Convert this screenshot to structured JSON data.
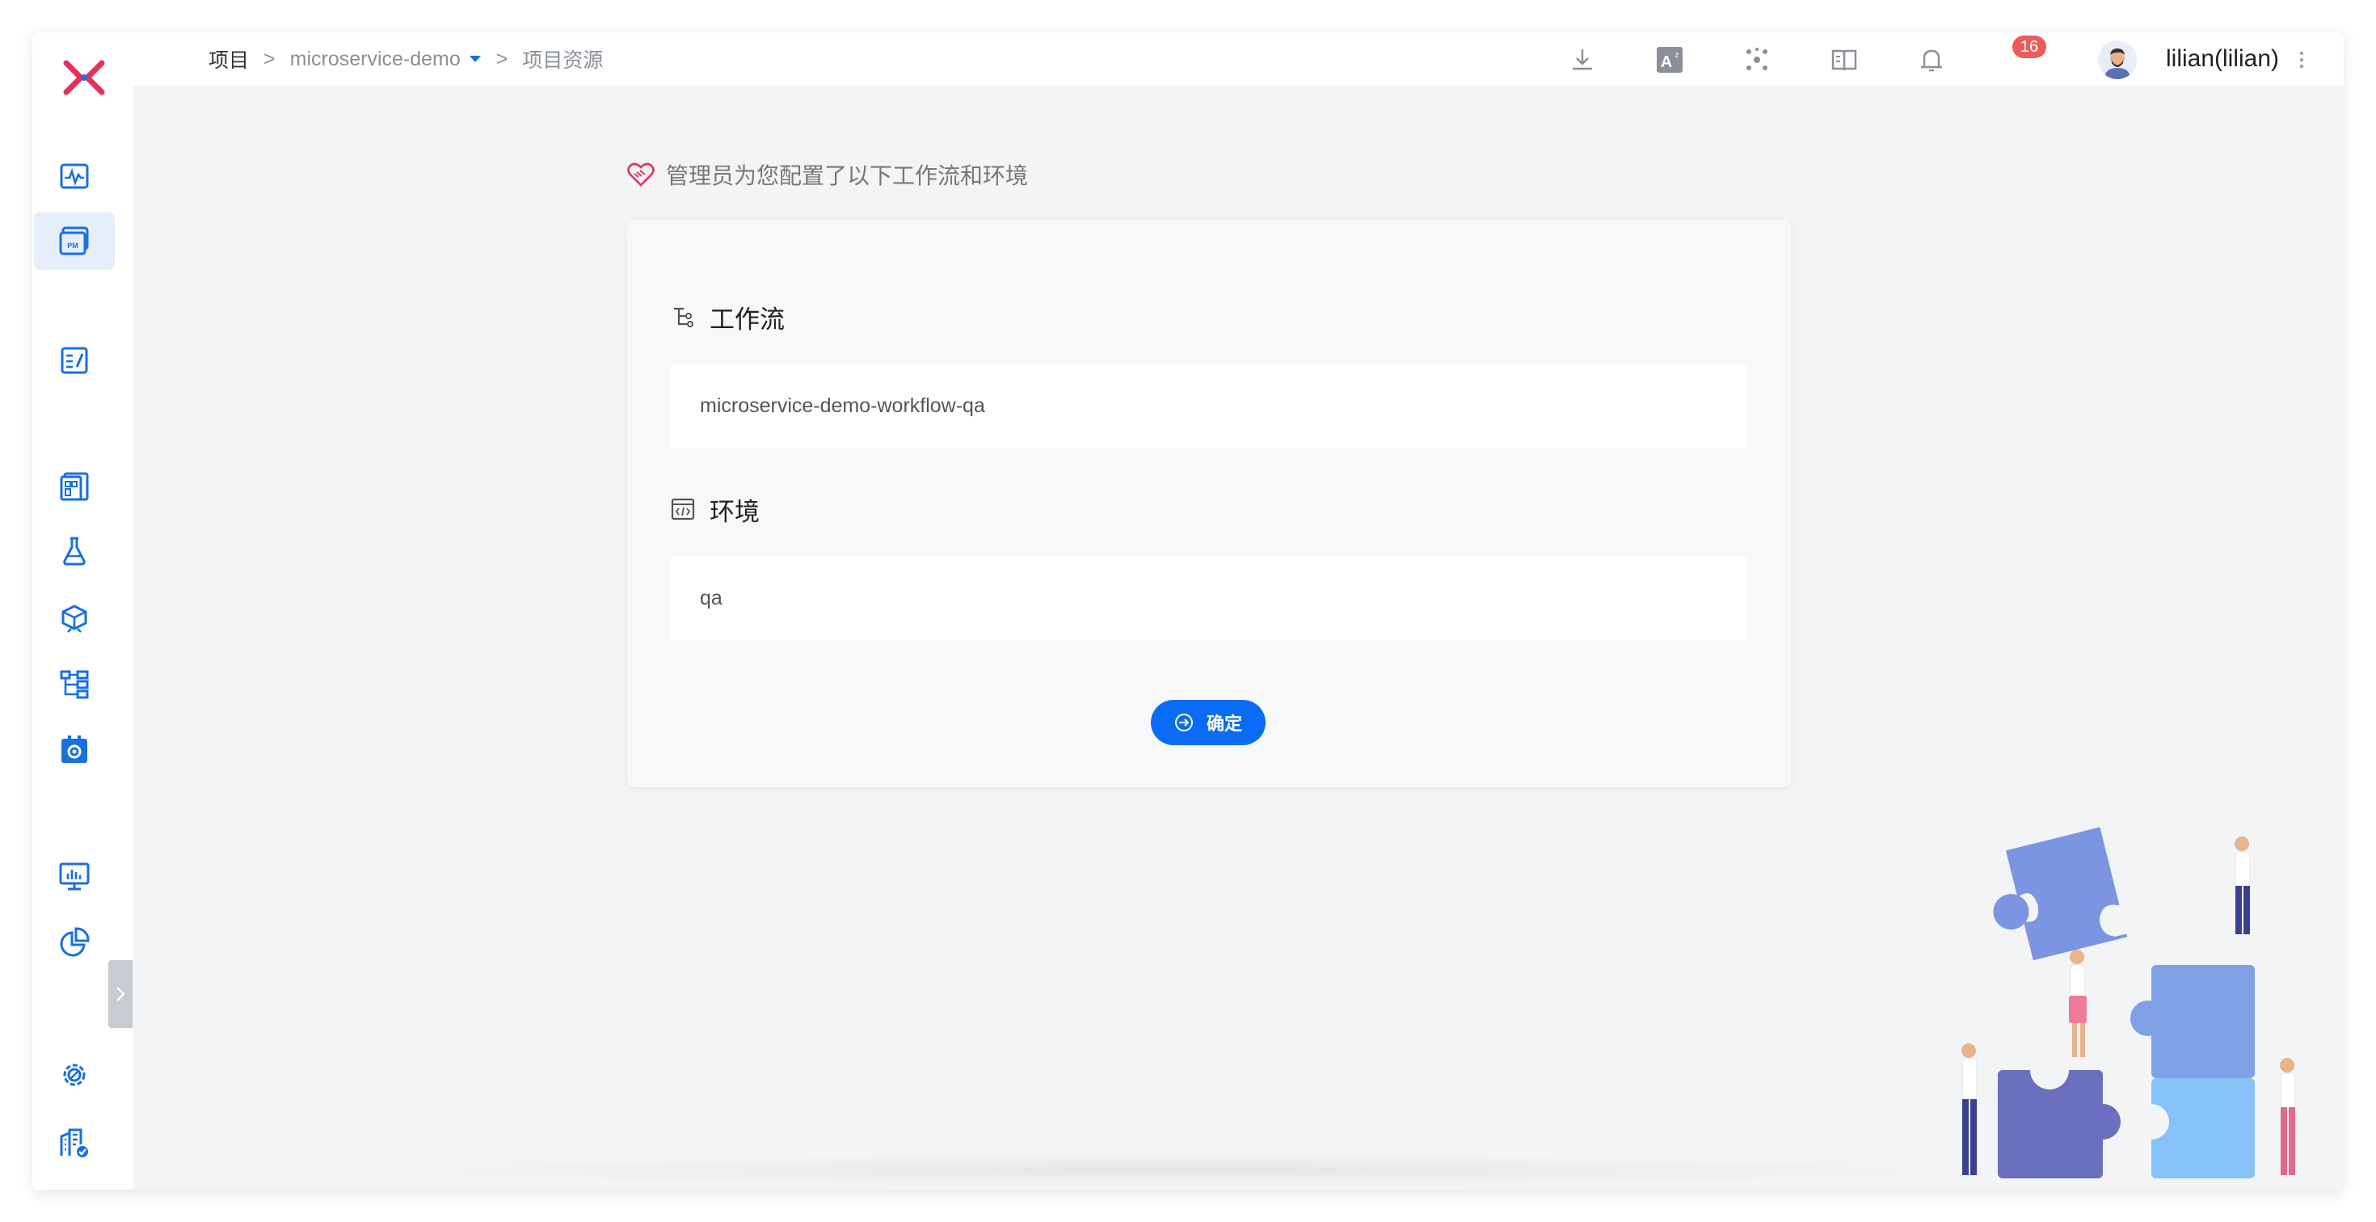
{
  "sidebar": {
    "logo": "zadig-logo",
    "items": [
      {
        "name": "monitor-pulse-icon"
      },
      {
        "name": "project-pm-icon",
        "label": "PM",
        "active": true
      },
      {
        "name": "edit-doc-icon"
      },
      {
        "name": "dashboard-grid-icon"
      },
      {
        "name": "flask-icon"
      },
      {
        "name": "package-icon"
      },
      {
        "name": "workflow-tree-icon"
      },
      {
        "name": "settings-box-icon"
      },
      {
        "name": "monitor-chart-icon"
      },
      {
        "name": "pie-chart-icon"
      },
      {
        "name": "gear-icon"
      },
      {
        "name": "building-check-icon"
      }
    ]
  },
  "breadcrumb": {
    "root": "项目",
    "sep": ">",
    "project": "microservice-demo",
    "current": "项目资源"
  },
  "topbar": {
    "icons": [
      "download-icon",
      "translate-icon",
      "cluster-icon",
      "book-icon",
      "bell-icon"
    ],
    "notifications": "16",
    "username": "lilian(lilian)"
  },
  "main": {
    "notice": "管理员为您配置了以下工作流和环境",
    "workflow_title": "工作流",
    "workflow_value": "microservice-demo-workflow-qa",
    "env_title": "环境",
    "env_value": "qa",
    "confirm_label": "确定"
  },
  "colors": {
    "accent": "#0a6cf5",
    "brand": "#e8315a",
    "badge": "#f05a5a",
    "background": "#f3f4f5"
  }
}
